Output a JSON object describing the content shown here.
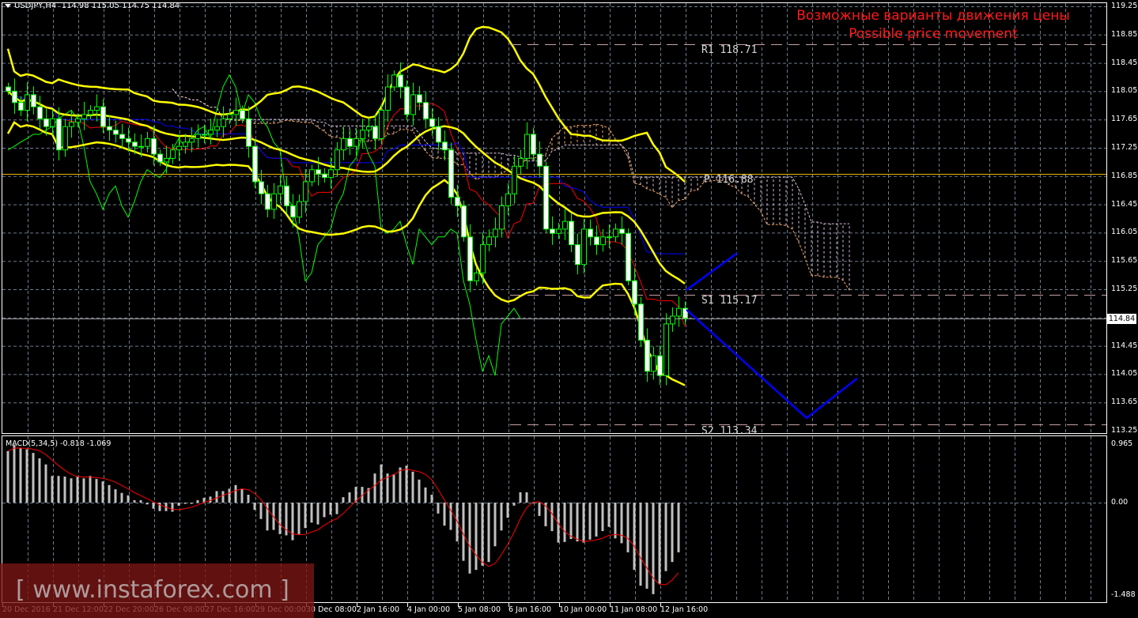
{
  "header": {
    "symbol": "USDJPY,H4",
    "open": "114.98",
    "high": "115.05",
    "low": "114.75",
    "close": "114.84"
  },
  "annotation": {
    "title_ru": "Возможные варианты движения цены",
    "title_en": "Possible price movement"
  },
  "levels": [
    {
      "label": "R1 118.71",
      "price": 118.71,
      "style": "dashed",
      "color": "#c8a0a0"
    },
    {
      "label": "P 116.88",
      "price": 116.88,
      "style": "solid",
      "color": "#e6b800"
    },
    {
      "label": "S1 115.17",
      "price": 115.17,
      "style": "dashed",
      "color": "#c8a0a0"
    },
    {
      "label": "S2 113.34",
      "price": 113.34,
      "style": "dashed",
      "color": "#c8a0a0"
    }
  ],
  "price_axis": {
    "ticks": [
      "119.25",
      "118.85",
      "118.45",
      "118.05",
      "117.65",
      "117.25",
      "116.85",
      "116.45",
      "116.05",
      "115.65",
      "115.25",
      "114.45",
      "114.05",
      "113.65",
      "113.25"
    ],
    "current": "114.84"
  },
  "macd_axis": {
    "ticks": [
      "0.965",
      "0.00",
      "-1.488"
    ]
  },
  "time_axis": [
    "20 Dec 2016",
    "21 Dec 12:00",
    "22 Dec 20:00",
    "26 Dec 08:00",
    "27 Dec 16:00",
    "29 Dec 00:00",
    "30 Dec 08:00",
    "2 Jan 16:00",
    "4 Jan 00:00",
    "5 Jan 08:00",
    "6 Jan 16:00",
    "10 Jan 00:00",
    "11 Jan 08:00",
    "12 Jan 16:00"
  ],
  "macd": {
    "label": "MACD(5,34,5) -0.818 -1.069",
    "params": [
      5,
      34,
      5
    ],
    "histogram": [
      0.85,
      0.95,
      0.9,
      0.88,
      0.82,
      0.73,
      0.63,
      0.44,
      0.44,
      0.43,
      0.4,
      0.43,
      0.4,
      0.44,
      0.39,
      0.35,
      0.29,
      0.22,
      0.16,
      0.12,
      0.04,
      0.04,
      -0.03,
      -0.1,
      -0.14,
      -0.14,
      -0.15,
      -0.05,
      -0.02,
      -0.02,
      0.04,
      0.08,
      0.1,
      0.19,
      0.19,
      0.23,
      0.29,
      0.23,
      0.13,
      -0.12,
      -0.27,
      -0.46,
      -0.45,
      -0.52,
      -0.54,
      -0.62,
      -0.52,
      -0.42,
      -0.33,
      -0.36,
      -0.24,
      -0.2,
      -0.19,
      0.09,
      0.17,
      0.26,
      0.26,
      0.24,
      0.48,
      0.63,
      0.48,
      0.47,
      0.58,
      0.61,
      0.51,
      0.38,
      0.25,
      0.13,
      -0.18,
      -0.38,
      -0.45,
      -0.64,
      -0.96,
      -1.17,
      -1.11,
      -1.04,
      -0.98,
      -0.72,
      -0.46,
      -0.25,
      -0.05,
      0.17,
      0.17,
      0.0,
      -0.22,
      -0.39,
      -0.47,
      -0.66,
      -0.65,
      -0.6,
      -0.64,
      -0.66,
      -0.61,
      -0.56,
      -0.47,
      -0.4,
      -0.59,
      -0.67,
      -0.82,
      -1.11,
      -1.37,
      -1.42,
      -1.51,
      -1.34,
      -1.13,
      -0.98,
      -0.82
    ],
    "colors": {
      "histogram": "#c0c0c0",
      "signal": "#ff0000"
    }
  },
  "chart_data": {
    "type": "candlestick",
    "timeframe": "H4",
    "ylim": [
      113.25,
      119.25
    ],
    "closes": [
      118.05,
      117.89,
      117.78,
      118.0,
      117.83,
      117.66,
      117.55,
      117.66,
      117.22,
      117.55,
      117.61,
      117.66,
      117.72,
      117.78,
      117.83,
      117.55,
      117.5,
      117.44,
      117.38,
      117.33,
      117.27,
      117.27,
      117.38,
      117.16,
      117.05,
      117.1,
      117.22,
      117.27,
      117.33,
      117.38,
      117.44,
      117.44,
      117.5,
      117.55,
      117.66,
      117.72,
      117.78,
      117.66,
      117.27,
      116.77,
      116.6,
      116.38,
      116.6,
      116.71,
      116.43,
      116.27,
      116.49,
      116.77,
      116.94,
      116.88,
      116.83,
      116.94,
      117.22,
      117.38,
      117.27,
      117.38,
      117.5,
      117.55,
      117.38,
      117.78,
      118.11,
      118.28,
      118.11,
      117.72,
      118.0,
      117.89,
      117.66,
      117.55,
      117.33,
      117.22,
      116.55,
      116.43,
      115.99,
      115.37,
      115.48,
      115.88,
      115.99,
      116.1,
      116.43,
      116.6,
      116.99,
      117.1,
      117.44,
      117.16,
      116.99,
      116.1,
      116.04,
      116.1,
      116.21,
      115.88,
      115.6,
      116.1,
      115.99,
      115.88,
      115.99,
      115.99,
      116.1,
      116.04,
      115.37,
      115.04,
      114.53,
      114.09,
      114.31,
      114.03,
      114.76,
      114.87,
      114.98,
      114.84
    ],
    "indicators": [
      "Bollinger Bands",
      "Ichimoku Kinko Hyo",
      "MACD(5,34,5)"
    ],
    "colors": {
      "candle_border": "#00ff00",
      "bear_body": "#ffffff",
      "bull_body": "#000000",
      "bollinger": "#ffff00",
      "tenkan": "#ff0000",
      "kijun": "#0000ff",
      "chikou": "#00ff00",
      "senkou_a": "#f4a460",
      "senkou_b": "#d8bfd8",
      "forecast": "#0000ff"
    },
    "forecast_paths": [
      {
        "direction": "up",
        "points": [
          {
            "bar": 108,
            "price": 115.24
          },
          {
            "bar": 116,
            "price": 115.76
          }
        ]
      },
      {
        "direction": "down",
        "points": [
          {
            "bar": 108,
            "price": 114.96
          },
          {
            "bar": 127,
            "price": 113.43
          },
          {
            "bar": 135,
            "price": 113.99
          }
        ]
      }
    ]
  },
  "watermark": "[ www.instaforex.com ]"
}
